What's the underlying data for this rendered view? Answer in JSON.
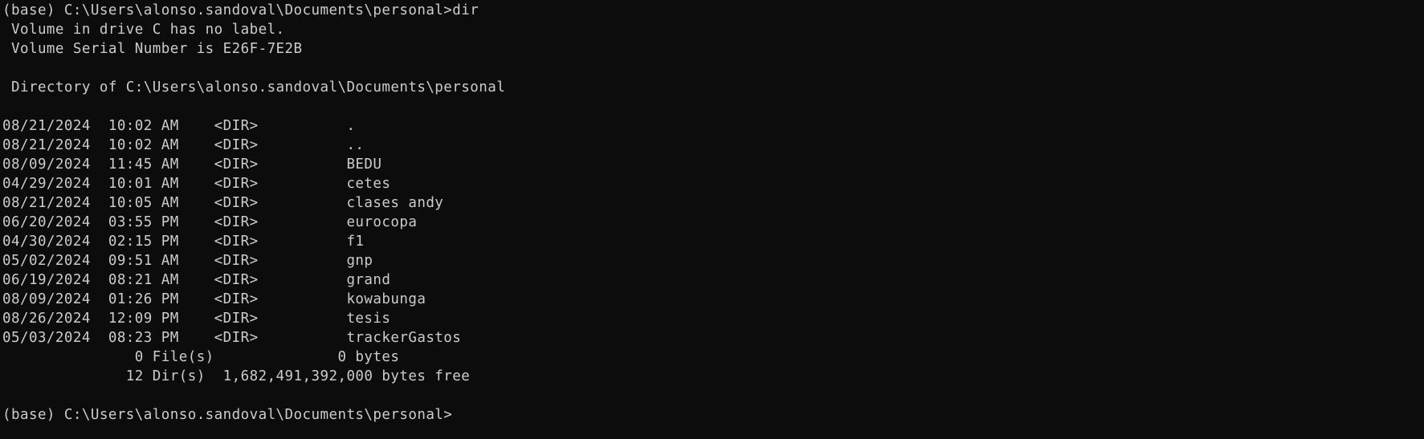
{
  "terminal": {
    "background": "#0c0c0c",
    "foreground": "#cccccc",
    "command_line": "(base) C:\\Users\\alonso.sandoval\\Documents\\personal>dir",
    "volume_label": " Volume in drive C has no label.",
    "volume_serial": " Volume Serial Number is E26F-7E2B",
    "blank1": "",
    "directory_of": " Directory of C:\\Users\\alonso.sandoval\\Documents\\personal",
    "blank2": "",
    "entries": [
      "08/21/2024  10:02 AM    <DIR>          .",
      "08/21/2024  10:02 AM    <DIR>          ..",
      "08/09/2024  11:45 AM    <DIR>          BEDU",
      "04/29/2024  10:01 AM    <DIR>          cetes",
      "08/21/2024  10:05 AM    <DIR>          clases andy",
      "06/20/2024  03:55 PM    <DIR>          eurocopa",
      "04/30/2024  02:15 PM    <DIR>          f1",
      "05/02/2024  09:51 AM    <DIR>          gnp",
      "06/19/2024  08:21 AM    <DIR>          grand",
      "08/09/2024  01:26 PM    <DIR>          kowabunga",
      "08/26/2024  12:09 PM    <DIR>          tesis",
      "05/03/2024  08:23 PM    <DIR>          trackerGastos"
    ],
    "files_summary": "               0 File(s)              0 bytes",
    "dirs_summary": "              12 Dir(s)  1,682,491,392,000 bytes free",
    "blank3": "",
    "prompt": "(base) C:\\Users\\alonso.sandoval\\Documents\\personal>"
  }
}
